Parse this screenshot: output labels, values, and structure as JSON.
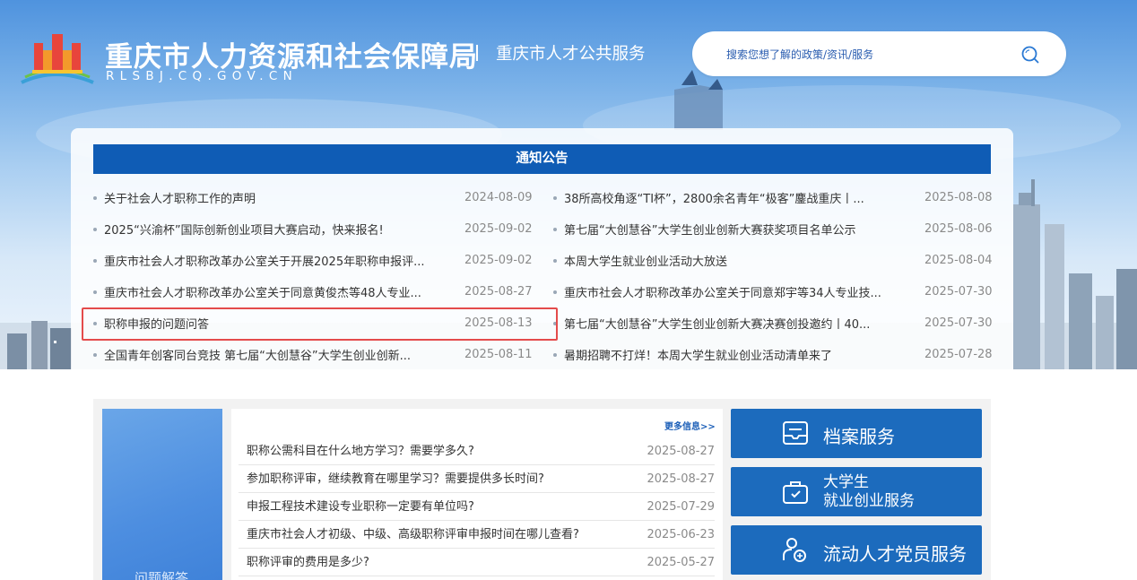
{
  "header": {
    "site_title": "重庆市人力资源和社会保障局",
    "site_domain": "RLSBJ.CQ.GOV.CN",
    "divider": "|",
    "site_subtitle": "重庆市人才公共服务",
    "search": {
      "placeholder": "搜索您想了解的政策/资讯/服务"
    }
  },
  "notices": {
    "title": "通知公告",
    "left": [
      {
        "text": "关于社会人才职称工作的声明",
        "date": "2024-08-09"
      },
      {
        "text": "2025“兴渝杯”国际创新创业项目大赛启动，快来报名!",
        "date": "2025-09-02"
      },
      {
        "text": "重庆市社会人才职称改革办公室关于开展2025年职称申报评...",
        "date": "2025-09-02"
      },
      {
        "text": "重庆市社会人才职称改革办公室关于同意黄俊杰等48人专业...",
        "date": "2025-08-27"
      },
      {
        "text": "职称申报的问题问答",
        "date": "2025-08-13"
      },
      {
        "text": "全国青年创客同台竞技 第七届“大创慧谷”大学生创业创新...",
        "date": "2025-08-11"
      }
    ],
    "right": [
      {
        "text": "38所高校角逐“TI杯”，2800余名青年“极客”鏖战重庆丨...",
        "date": "2025-08-08"
      },
      {
        "text": "第七届“大创慧谷”大学生创业创新大赛获奖项目名单公示",
        "date": "2025-08-06"
      },
      {
        "text": "本周大学生就业创业活动大放送",
        "date": "2025-08-04"
      },
      {
        "text": "重庆市社会人才职称改革办公室关于同意郑宇等34人专业技...",
        "date": "2025-07-30"
      },
      {
        "text": "第七届“大创慧谷”大学生创业创新大赛决赛创投邀约丨40...",
        "date": "2025-07-30"
      },
      {
        "text": "暑期招聘不打烊！本周大学生就业创业活动清单来了",
        "date": "2025-07-28"
      }
    ]
  },
  "qa": {
    "section_label": "问题解答",
    "more": "更多信息>>",
    "items": [
      {
        "text": "职称公需科目在什么地方学习？需要学多久?",
        "date": "2025-08-27"
      },
      {
        "text": "参加职称评审，继续教育在哪里学习？需要提供多长时间?",
        "date": "2025-08-27"
      },
      {
        "text": "申报工程技术建设专业职称一定要有单位吗?",
        "date": "2025-07-29"
      },
      {
        "text": "重庆市社会人才初级、中级、高级职称评审申报时间在哪儿查看?",
        "date": "2025-06-23"
      },
      {
        "text": "职称评审的费用是多少?",
        "date": "2025-05-27"
      }
    ]
  },
  "services": {
    "archive": "档案服务",
    "student_line1": "大学生",
    "student_line2": "就业创业服务",
    "party": "流动人才党员服务"
  },
  "colors": {
    "primary_blue": "#0f5cb5",
    "service_blue": "#1c6bbd",
    "highlight_red": "#e44b4b"
  }
}
